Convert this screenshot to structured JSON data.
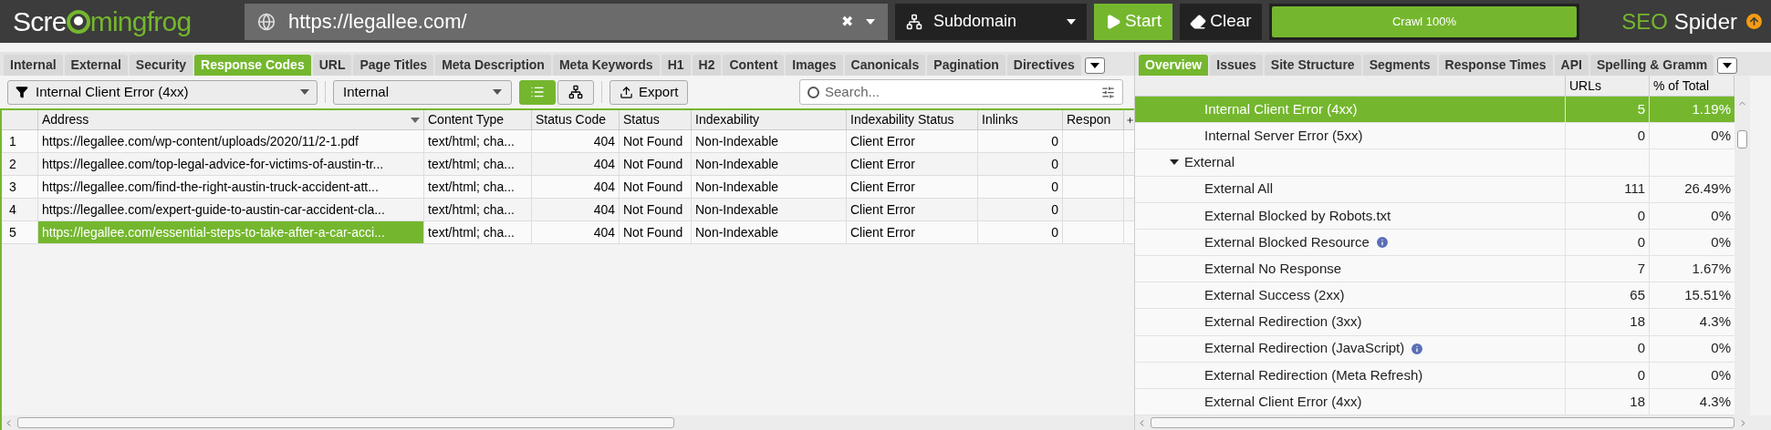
{
  "top_bar": {
    "logo": {
      "left": "Scre",
      "right": "mingfrog"
    },
    "url": "https://legallee.com/",
    "clear_glyph": "✖",
    "mode": "Subdomain",
    "start": "Start",
    "clear": "Clear",
    "progress": {
      "label": "Crawl 100%",
      "level": 1
    },
    "product": {
      "first": "SEO",
      "second": "Spider"
    }
  },
  "left_tabs": [
    {
      "label": "Internal",
      "selected": false
    },
    {
      "label": "External",
      "selected": false
    },
    {
      "label": "Security",
      "selected": false
    },
    {
      "label": "Response Codes",
      "selected": true
    },
    {
      "label": "URL",
      "selected": false
    },
    {
      "label": "Page Titles",
      "selected": false
    },
    {
      "label": "Meta Description",
      "selected": false
    },
    {
      "label": "Meta Keywords",
      "selected": false
    },
    {
      "label": "H1",
      "selected": false
    },
    {
      "label": "H2",
      "selected": false
    },
    {
      "label": "Content",
      "selected": false
    },
    {
      "label": "Images",
      "selected": false
    },
    {
      "label": "Canonicals",
      "selected": false
    },
    {
      "label": "Pagination",
      "selected": false
    },
    {
      "label": "Directives",
      "selected": false
    }
  ],
  "toolbar": {
    "filter": "Internal Client Error (4xx)",
    "scope": "Internal",
    "views": [
      {
        "kind": "list",
        "selected": true
      },
      {
        "kind": "tree",
        "selected": false
      }
    ],
    "export": "Export",
    "search": {
      "placeholder": "Search..."
    }
  },
  "table": {
    "columns": [
      "Address",
      "Content Type",
      "Status Code",
      "Status",
      "Indexability",
      "Indexability Status",
      "Inlinks",
      "Respon"
    ],
    "rows": [
      {
        "n": "1",
        "address": "https://legallee.com/wp-content/uploads/2020/11/2-1.pdf",
        "content_type": "text/html; cha...",
        "status_code": "404",
        "status": "Not Found",
        "indexability": "Non-Indexable",
        "indexability_status": "Client Error",
        "inlinks": "0",
        "selected": false
      },
      {
        "n": "2",
        "address": "https://legallee.com/top-legal-advice-for-victims-of-austin-tr...",
        "content_type": "text/html; cha...",
        "status_code": "404",
        "status": "Not Found",
        "indexability": "Non-Indexable",
        "indexability_status": "Client Error",
        "inlinks": "0",
        "selected": false
      },
      {
        "n": "3",
        "address": "https://legallee.com/find-the-right-austin-truck-accident-att...",
        "content_type": "text/html; cha...",
        "status_code": "404",
        "status": "Not Found",
        "indexability": "Non-Indexable",
        "indexability_status": "Client Error",
        "inlinks": "0",
        "selected": false
      },
      {
        "n": "4",
        "address": "https://legallee.com/expert-guide-to-austin-car-accident-cla...",
        "content_type": "text/html; cha...",
        "status_code": "404",
        "status": "Not Found",
        "indexability": "Non-Indexable",
        "indexability_status": "Client Error",
        "inlinks": "0",
        "selected": false
      },
      {
        "n": "5",
        "address": "https://legallee.com/essential-steps-to-take-after-a-car-acci...",
        "content_type": "text/html; cha...",
        "status_code": "404",
        "status": "Not Found",
        "indexability": "Non-Indexable",
        "indexability_status": "Client Error",
        "inlinks": "0",
        "selected": true
      }
    ]
  },
  "right_tabs": [
    {
      "label": "Overview",
      "selected": true
    },
    {
      "label": "Issues",
      "selected": false
    },
    {
      "label": "Site Structure",
      "selected": false
    },
    {
      "label": "Segments",
      "selected": false
    },
    {
      "label": "Response Times",
      "selected": false
    },
    {
      "label": "API",
      "selected": false
    },
    {
      "label": "Spelling & Gramm",
      "selected": false
    }
  ],
  "overview": {
    "columns": [
      "URLs",
      "% of Total"
    ],
    "rows": [
      {
        "label": "Internal Client Error (4xx)",
        "urls": "5",
        "percent": "1.19%",
        "info": false,
        "selected": true
      },
      {
        "label": "Internal Server Error (5xx)",
        "urls": "0",
        "percent": "0%",
        "info": false,
        "selected": false
      },
      {
        "label": "External",
        "expanded": true,
        "selected": false,
        "children": [
          {
            "label": "External All",
            "urls": "111",
            "percent": "26.49%",
            "info": false,
            "selected": false
          },
          {
            "label": "External Blocked by Robots.txt",
            "urls": "0",
            "percent": "0%",
            "info": false,
            "selected": false
          },
          {
            "label": "External Blocked Resource",
            "urls": "0",
            "percent": "0%",
            "info": true,
            "selected": false
          },
          {
            "label": "External No Response",
            "urls": "7",
            "percent": "1.67%",
            "info": false,
            "selected": false
          },
          {
            "label": "External Success (2xx)",
            "urls": "65",
            "percent": "15.51%",
            "info": false,
            "selected": false
          },
          {
            "label": "External Redirection (3xx)",
            "urls": "18",
            "percent": "4.3%",
            "info": false,
            "selected": false
          },
          {
            "label": "External Redirection (JavaScript)",
            "urls": "0",
            "percent": "0%",
            "info": true,
            "selected": false
          },
          {
            "label": "External Redirection (Meta Refresh)",
            "urls": "0",
            "percent": "0%",
            "info": false,
            "selected": false
          },
          {
            "label": "External Client Error (4xx)",
            "urls": "18",
            "percent": "4.3%",
            "info": false,
            "selected": false
          }
        ]
      }
    ]
  }
}
